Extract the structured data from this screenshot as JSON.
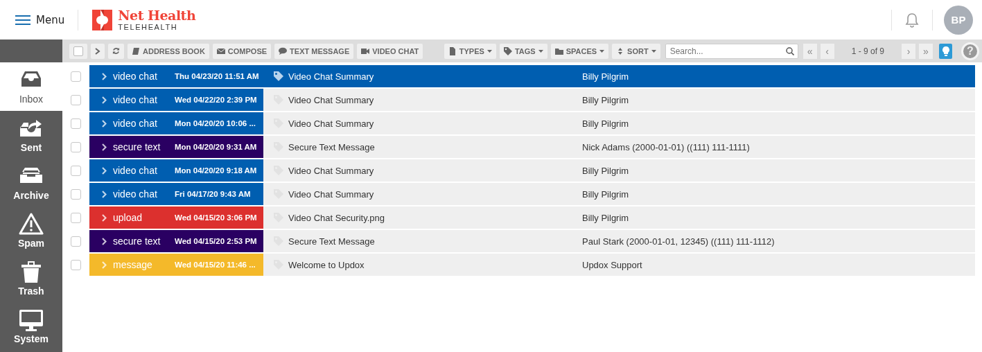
{
  "header": {
    "menu_label": "Menu",
    "brand_name": "Net Health",
    "brand_sub": "TELEHEALTH",
    "avatar_initials": "BP"
  },
  "toolbar": {
    "actions": [
      {
        "kind": "book",
        "label": "ADDRESS BOOK"
      },
      {
        "kind": "envelope",
        "label": "COMPOSE"
      },
      {
        "kind": "bubble",
        "label": "TEXT MESSAGE"
      },
      {
        "kind": "camera",
        "label": "VIDEO CHAT"
      }
    ],
    "filters": [
      {
        "kind": "file",
        "label": "TYPES"
      },
      {
        "kind": "tag",
        "label": "TAGS"
      },
      {
        "kind": "folder",
        "label": "SPACES"
      },
      {
        "kind": "updown",
        "label": "SORT"
      }
    ],
    "select_all_checked": false,
    "search_placeholder": "Search...",
    "pager": {
      "first": "«",
      "prev": "‹",
      "range": "1 - 9 of 9",
      "next": "›",
      "last": "»"
    },
    "help": "?"
  },
  "sidebar": {
    "items": [
      {
        "kind": "inbox",
        "label": "Inbox",
        "selected": true
      },
      {
        "kind": "sent",
        "label": "Sent",
        "selected": false
      },
      {
        "kind": "archive",
        "label": "Archive",
        "selected": false
      },
      {
        "kind": "spam",
        "label": "Spam",
        "selected": false
      },
      {
        "kind": "trash",
        "label": "Trash",
        "selected": false
      },
      {
        "kind": "system",
        "label": "System",
        "selected": false
      }
    ]
  },
  "messages": [
    {
      "type": "video chat",
      "color": "#005eb0",
      "date": "Thu 04/23/20 11:51 AM",
      "subject": "Video Chat Summary",
      "sender": "Billy Pilgrim",
      "checked": false,
      "selected": true
    },
    {
      "type": "video chat",
      "color": "#005eb0",
      "date": "Wed 04/22/20 2:39 PM",
      "subject": "Video Chat Summary",
      "sender": "Billy Pilgrim",
      "checked": false,
      "selected": false
    },
    {
      "type": "video chat",
      "color": "#005eb0",
      "date": "Mon 04/20/20 10:06 ...",
      "subject": "Video Chat Summary",
      "sender": "Billy Pilgrim",
      "checked": false,
      "selected": false
    },
    {
      "type": "secure text",
      "color": "#2a0062",
      "date": "Mon 04/20/20 9:31 AM",
      "subject": "Secure Text Message",
      "sender": "Nick Adams (2000-01-01) ((111) 111-1111)",
      "checked": false,
      "selected": false
    },
    {
      "type": "video chat",
      "color": "#005eb0",
      "date": "Mon 04/20/20 9:18 AM",
      "subject": "Video Chat Summary",
      "sender": "Billy Pilgrim",
      "checked": false,
      "selected": false
    },
    {
      "type": "video chat",
      "color": "#005eb0",
      "date": "Fri 04/17/20 9:43 AM",
      "subject": "Video Chat Summary",
      "sender": "Billy Pilgrim",
      "checked": false,
      "selected": false
    },
    {
      "type": "upload",
      "color": "#dc302e",
      "date": "Wed 04/15/20 3:06 PM",
      "subject": "Video Chat Security.png",
      "sender": "Billy Pilgrim",
      "checked": false,
      "selected": false
    },
    {
      "type": "secure text",
      "color": "#2a0062",
      "date": "Wed 04/15/20 2:53 PM",
      "subject": "Secure Text Message",
      "sender": "Paul Stark (2000-01-01, 12345) ((111) 111-1112)",
      "checked": false,
      "selected": false
    },
    {
      "type": "message",
      "color": "#f4b92a",
      "date": "Wed 04/15/20 11:46 ...",
      "subject": "Welcome to Updox",
      "sender": "Updox Support",
      "checked": false,
      "selected": false
    }
  ]
}
